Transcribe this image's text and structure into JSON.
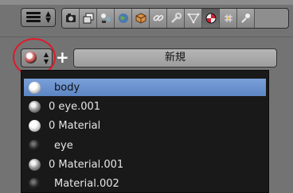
{
  "header": {
    "editor_type_icon": "properties-editor-icon",
    "context_tabs": [
      {
        "name": "render-icon"
      },
      {
        "name": "render-layers-icon"
      },
      {
        "name": "scene-icon"
      },
      {
        "name": "world-icon"
      },
      {
        "name": "object-icon"
      },
      {
        "name": "constraints-icon"
      },
      {
        "name": "modifiers-icon"
      },
      {
        "name": "data-icon"
      },
      {
        "name": "material-icon",
        "active": true
      },
      {
        "name": "texture-icon"
      },
      {
        "name": "particles-icon"
      }
    ]
  },
  "material_slot": {
    "new_button_label": "新規",
    "add_icon": "plus-icon"
  },
  "browse_list": {
    "items": [
      {
        "label": "body",
        "swatch": "white",
        "selected": true
      },
      {
        "label": "0 eye.001",
        "swatch": "grey"
      },
      {
        "label": "0 Material",
        "swatch": "white"
      },
      {
        "label": "eye",
        "swatch": "dark"
      },
      {
        "label": "0 Material.001",
        "swatch": "grey"
      },
      {
        "label": "Material.002",
        "swatch": "dark"
      }
    ]
  },
  "colors": {
    "selection": "#5d85c4",
    "highlight_circle": "#e0192a",
    "panel_bg": "#737373",
    "menu_bg": "#191919"
  }
}
